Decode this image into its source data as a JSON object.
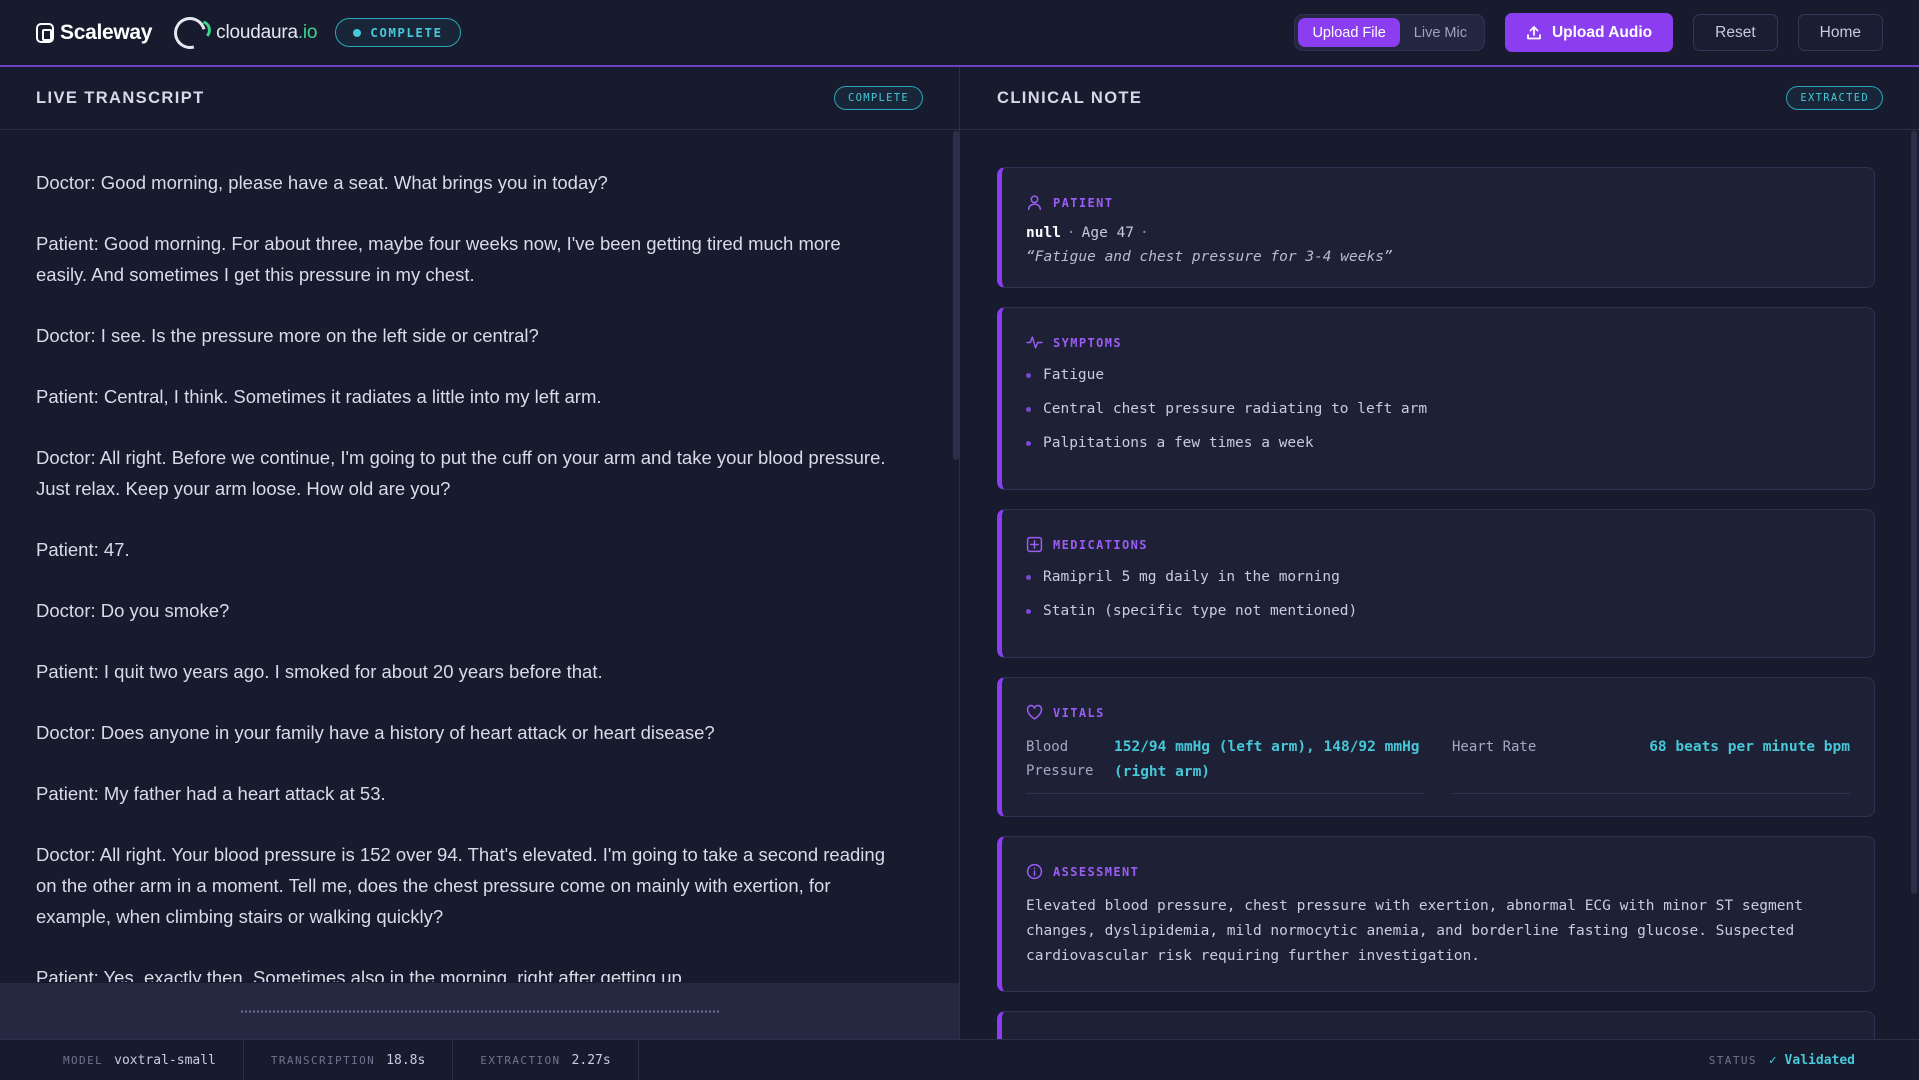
{
  "header": {
    "brand": "Scaleway",
    "partner_name": "cloudaura",
    "partner_tld": ".io",
    "status": "COMPLETE",
    "mode_options": [
      "Upload File",
      "Live Mic"
    ],
    "upload_audio": "Upload Audio",
    "reset": "Reset",
    "home": "Home"
  },
  "transcript": {
    "title": "LIVE TRANSCRIPT",
    "status": "COMPLETE",
    "lines": [
      "Doctor: Good morning, please have a seat. What brings you in today?",
      "Patient: Good morning. For about three, maybe four weeks now, I've been getting tired much more easily. And sometimes I get this pressure in my chest.",
      "Doctor: I see. Is the pressure more on the left side or central?",
      "Patient: Central, I think. Sometimes it radiates a little into my left arm.",
      "Doctor: All right. Before we continue, I'm going to put the cuff on your arm and take your blood pressure. Just relax. Keep your arm loose. How old are you?",
      "Patient: 47.",
      "Doctor: Do you smoke?",
      "Patient: I quit two years ago. I smoked for about 20 years before that.",
      "Doctor: Does anyone in your family have a history of heart attack or heart disease?",
      "Patient: My father had a heart attack at 53.",
      "Doctor: All right. Your blood pressure is 152 over 94. That's elevated. I'm going to take a second reading on the other arm in a moment. Tell me, does the chest pressure come on mainly with exertion, for example, when climbing stairs or walking quickly?",
      "Patient: Yes, exactly then. Sometimes also in the morning, right after getting up."
    ]
  },
  "note": {
    "title": "CLINICAL NOTE",
    "status": "EXTRACTED",
    "patient": {
      "label": "PATIENT",
      "name": "null",
      "age": "Age 47",
      "complaint": "“Fatigue and chest pressure for 3-4 weeks”"
    },
    "symptoms": {
      "label": "SYMPTOMS",
      "items": [
        "Fatigue",
        "Central chest pressure radiating to left arm",
        "Palpitations a few times a week"
      ]
    },
    "medications": {
      "label": "MEDICATIONS",
      "items": [
        "Ramipril 5 mg daily in the morning",
        "Statin (specific type not mentioned)"
      ]
    },
    "vitals": {
      "label": "VITALS",
      "bp_label": "Blood Pressure",
      "bp_value": "152/94 mmHg (left arm), 148/92 mmHg (right arm)",
      "hr_label": "Heart Rate",
      "hr_value": "68 beats per minute bpm"
    },
    "assessment": {
      "label": "ASSESSMENT",
      "text": "Elevated blood pressure, chest pressure with exertion, abnormal ECG with minor ST segment changes, dyslipidemia, mild normocytic anemia, and borderline fasting glucose. Suspected cardiovascular risk requiring further investigation."
    }
  },
  "footer": {
    "model_label": "MODEL",
    "model_value": "voxtral-small",
    "transcription_label": "TRANSCRIPTION",
    "transcription_value": "18.8s",
    "extraction_label": "EXTRACTION",
    "extraction_value": "2.27s",
    "status_label": "STATUS",
    "status_value": "✓ Validated"
  },
  "colors": {
    "accent": "#8b3df0",
    "teal": "#46c8d8",
    "background": "#181b2e",
    "card": "#1e2136"
  }
}
